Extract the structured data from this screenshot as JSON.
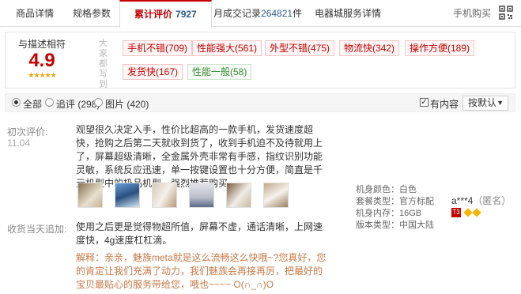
{
  "tabs": {
    "details": "商品详情",
    "specs": "规格参数",
    "reviews_label": "累计评价",
    "reviews_count": "7927",
    "monthly_label": "月成交记录",
    "monthly_count": "264821",
    "monthly_unit": "件",
    "service": "电器城服务详情",
    "mobile_buy": "手机购买"
  },
  "summary": {
    "title": "与描述相符",
    "score": "4.9",
    "stars": "★★★★★",
    "vertical_label": "大家都写到",
    "tags": [
      {
        "text": "手机不错(709)",
        "sentiment": "positive"
      },
      {
        "text": "性能强大(561)",
        "sentiment": "positive"
      },
      {
        "text": "外型不错(475)",
        "sentiment": "positive"
      },
      {
        "text": "物流快(342)",
        "sentiment": "positive"
      },
      {
        "text": "操作方便(189)",
        "sentiment": "positive"
      },
      {
        "text": "发货快(167)",
        "sentiment": "positive"
      },
      {
        "text": "性能一般(58)",
        "sentiment": "neutral"
      }
    ]
  },
  "filter": {
    "all": "全部",
    "append": "追评 (298)",
    "pictures": "图片 (420)",
    "has_content": "有内容",
    "sort": "按默认",
    "has_content_checked": true,
    "selected": "all"
  },
  "review": {
    "first_label": "初次评价:",
    "first_date": "11.04",
    "text": "观望很久决定入手，性价比超高的一款手机，发货速度超快，抢购之后第二天就收到货了，收到手机迫不及待就用上了，屏幕超级清晰，全金属外壳非常有手感，指纹识别功能灵敏，系统反应迅速，单一按键设置也十分方便，简直是千元机型中的极品机型，强烈推荐购买。",
    "thumbs": 6,
    "append_label": "收货当天追加:",
    "append_text": "使用之后更是觉得物超所值，屏幕不虚，通话清晰，上网速度快，4g速度杠杠滴。",
    "reply": "解释：亲亲，魅族meta就是这么流畅这么快哦~?您真好，您的肯定让我们充满了动力，我们魅族会再接再厉，把最好的宝贝最贴心的服务带给您，哦也~~~~ O(∩_∩)O",
    "specs": [
      "机身颜色：白色",
      "套餐类型：官方标配",
      "机身内存：16GB",
      "版本类型：中国大陆"
    ],
    "user": "a***4",
    "user_anon": "（匿名）",
    "level": "T3"
  }
}
